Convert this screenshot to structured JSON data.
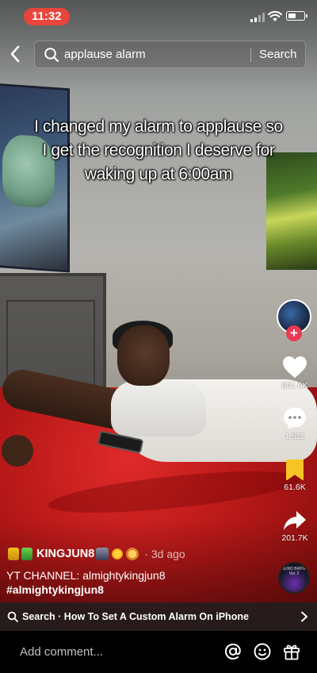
{
  "status_bar": {
    "time": "11:32"
  },
  "search": {
    "query": "applause alarm",
    "button_label": "Search"
  },
  "video": {
    "caption": "I changed my alarm to applause so I get the recognition I deserve for waking up at 6:00am"
  },
  "actions": {
    "likes": "861.6K",
    "comments": "1,511",
    "saves": "61.6K",
    "shares": "201.7K"
  },
  "music_disc_label": "JUND BRPG Vol. 2",
  "post": {
    "username": "KINGJUN8",
    "time_ago": "· 3d ago",
    "description_line": "YT CHANNEL: almightykingjun8",
    "hashtag": "#almightykingjun8"
  },
  "related_search": {
    "text": "Search · How To Set A Custom Alarm On iPhone"
  },
  "comment_bar": {
    "placeholder": "Add comment..."
  },
  "colors": {
    "follow_accent": "#ea3a55",
    "save_accent": "#f7c325",
    "time_pill": "#e8453c"
  }
}
